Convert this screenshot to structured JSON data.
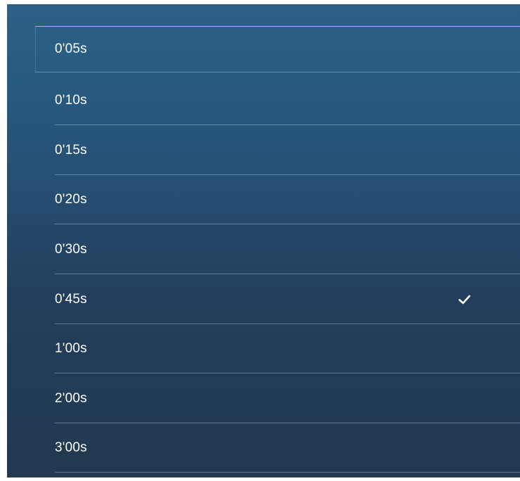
{
  "options": [
    {
      "label": "0'05s",
      "selected": false,
      "focused": true
    },
    {
      "label": "0'10s",
      "selected": false,
      "focused": false
    },
    {
      "label": "0'15s",
      "selected": false,
      "focused": false
    },
    {
      "label": "0'20s",
      "selected": false,
      "focused": false
    },
    {
      "label": "0'30s",
      "selected": false,
      "focused": false
    },
    {
      "label": "0'45s",
      "selected": true,
      "focused": false
    },
    {
      "label": "1'00s",
      "selected": false,
      "focused": false
    },
    {
      "label": "2'00s",
      "selected": false,
      "focused": false
    },
    {
      "label": "3'00s",
      "selected": false,
      "focused": false
    }
  ],
  "icons": {
    "selected_indicator": "checkmark-icon"
  },
  "colors": {
    "panel_top": "#2b6188",
    "panel_bottom": "#22394f",
    "text": "#ffffff",
    "focus_border": "#b9b88a"
  }
}
